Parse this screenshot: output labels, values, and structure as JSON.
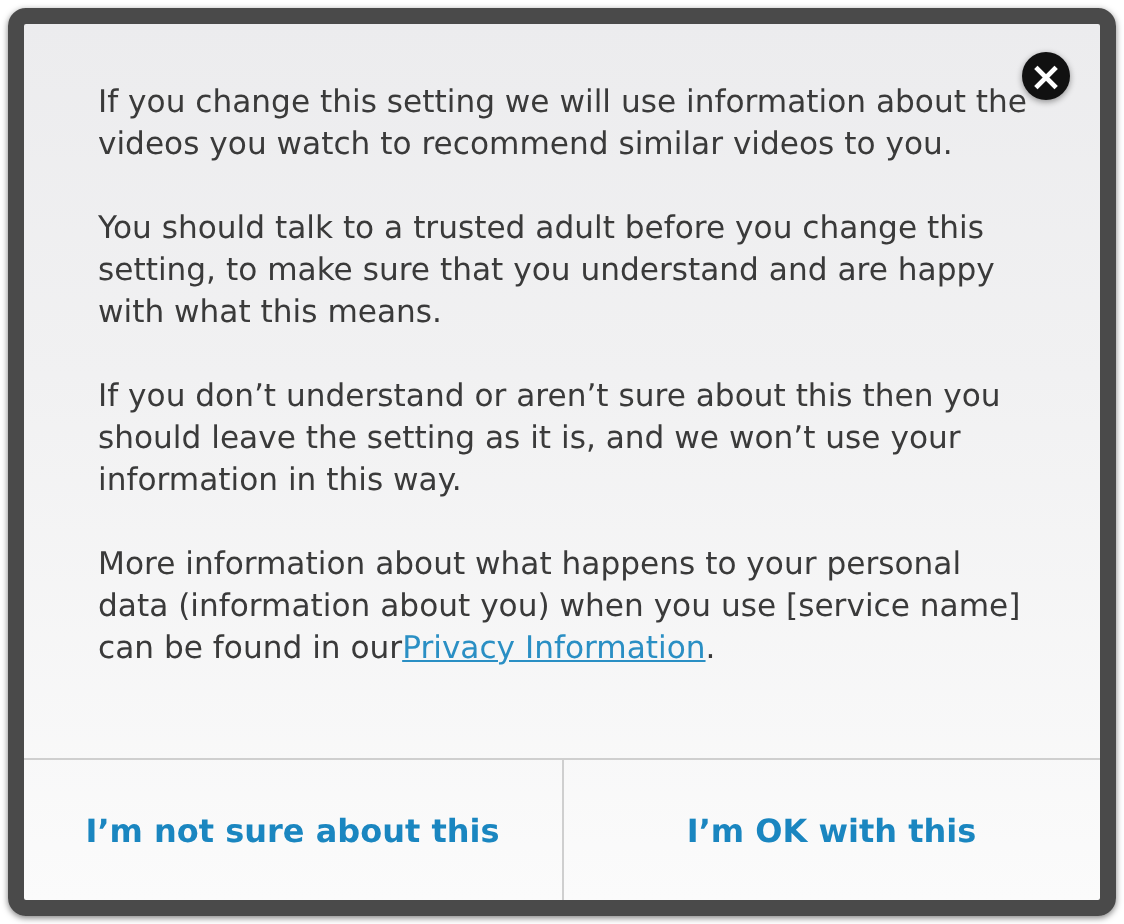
{
  "dialog": {
    "paragraphs": [
      {
        "text": "If you change this setting we will use information about the videos you watch to recommend similar videos to you."
      },
      {
        "text": "You should talk to a trusted adult before you change this setting, to make sure that you understand and are happy with what this means."
      },
      {
        "text": "If you don’t understand or aren’t sure about this then you should leave the setting as it is, and we won’t use your information in this way."
      },
      {
        "text": "More information about what happens to your personal data (information about you) when you use [service name] can be found in our",
        "link": "Privacy Information",
        "after": "."
      }
    ],
    "close_button": "×",
    "buttons": [
      {
        "label": "I’m not sure about this"
      },
      {
        "label": "I’m OK with this"
      }
    ]
  }
}
